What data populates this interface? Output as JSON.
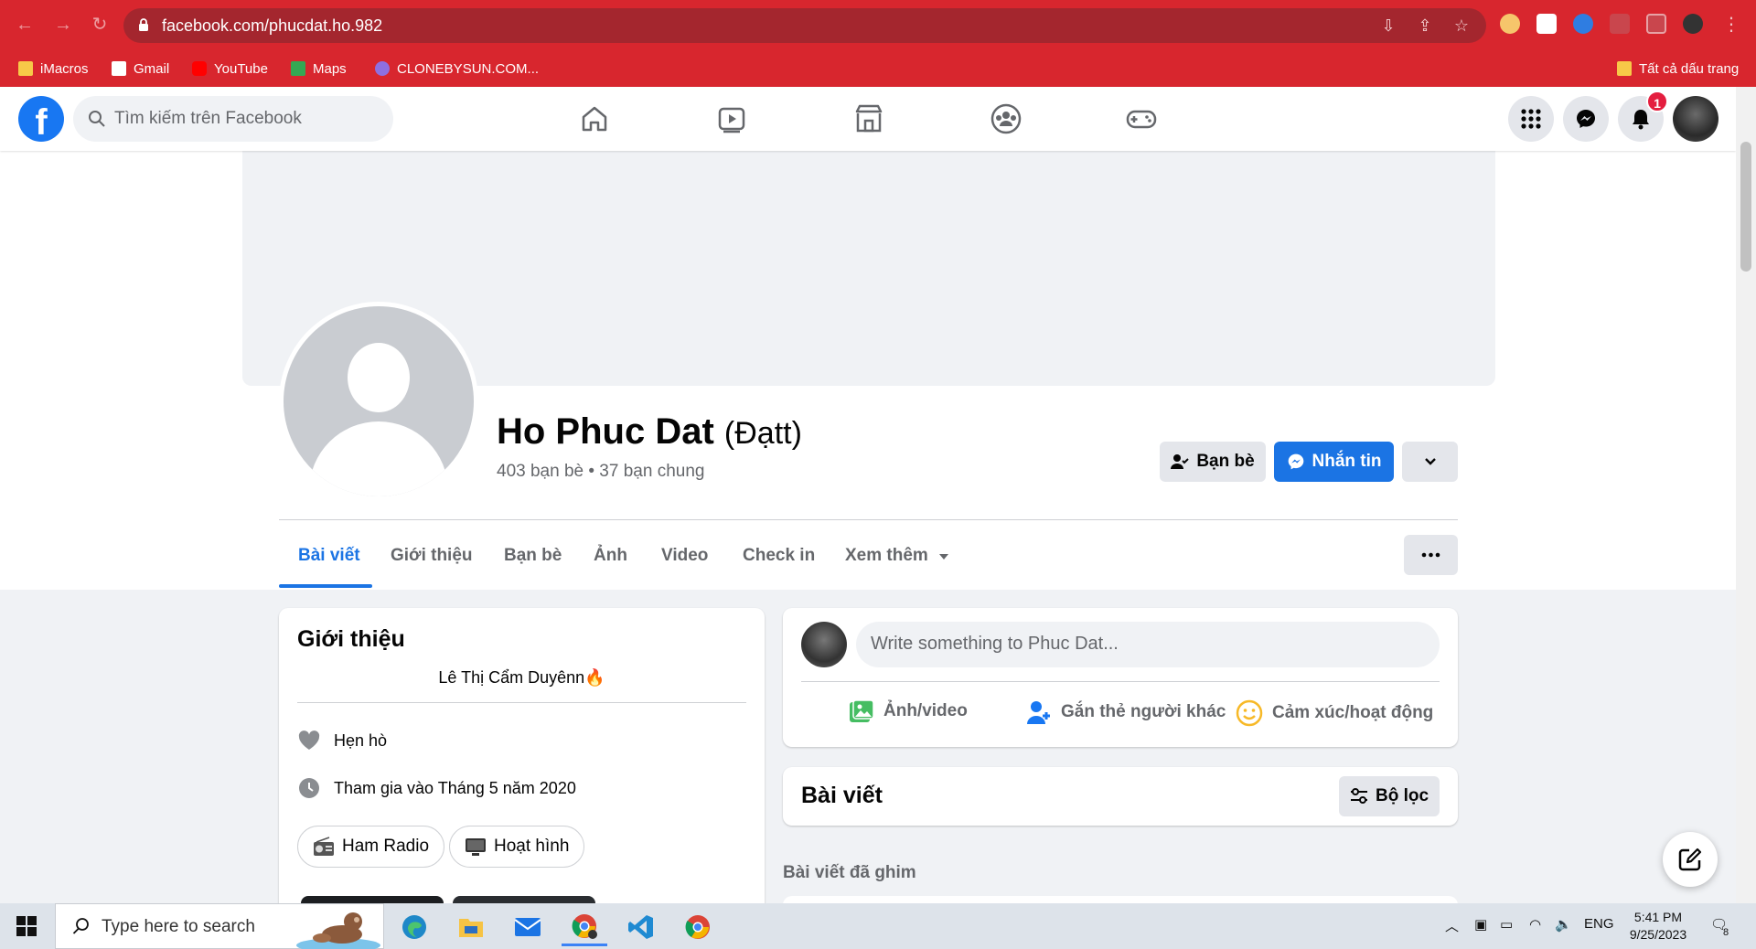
{
  "browser": {
    "url": "facebook.com/phucdat.ho.982",
    "bookmarks": [
      {
        "label": "iMacros"
      },
      {
        "label": "Gmail"
      },
      {
        "label": "YouTube"
      },
      {
        "label": "Maps"
      },
      {
        "label": "CLONEBYSUN.COM..."
      }
    ],
    "all_bookmarks_label": "Tất cả dấu trang"
  },
  "fb_header": {
    "logo_letter": "f",
    "search_placeholder": "Tìm kiếm trên Facebook",
    "notification_count": "1"
  },
  "profile": {
    "name": "Ho Phuc Dat",
    "alternate_name": "(Đạtt)",
    "friends_summary": "403 bạn bè • 37 bạn chung",
    "buttons": {
      "friends": "Bạn bè",
      "message": "Nhắn tin"
    },
    "tabs": [
      {
        "label": "Bài viết",
        "active": true
      },
      {
        "label": "Giới thiệu"
      },
      {
        "label": "Bạn bè"
      },
      {
        "label": "Ảnh"
      },
      {
        "label": "Video"
      },
      {
        "label": "Check in"
      },
      {
        "label": "Xem thêm"
      }
    ]
  },
  "intro": {
    "title": "Giới thiệu",
    "bio": "Lê Thị Cẩm Duyênn🔥",
    "relationship": "Hẹn hò",
    "joined": "Tham gia vào Tháng 5 năm 2020",
    "hobbies": [
      {
        "label": "Ham Radio"
      },
      {
        "label": "Hoạt hình"
      }
    ]
  },
  "composer": {
    "placeholder": "Write something to Phuc Dat...",
    "actions": [
      {
        "label": "Ảnh/video",
        "color": "#45bd62"
      },
      {
        "label": "Gắn thẻ người khác",
        "color": "#1877f2"
      },
      {
        "label": "Cảm xúc/hoạt động",
        "color": "#f7b928"
      }
    ]
  },
  "posts": {
    "title": "Bài viết",
    "filter_label": "Bộ lọc",
    "pinned_label": "Bài viết đã ghim"
  },
  "taskbar": {
    "search_placeholder": "Type here to search",
    "language": "ENG",
    "time": "5:41 PM",
    "date": "9/25/2023",
    "notification_count": "8"
  },
  "colors": {
    "browser_red": "#d8262e",
    "fb_blue": "#1877f2",
    "button_blue": "#1b74e4"
  }
}
